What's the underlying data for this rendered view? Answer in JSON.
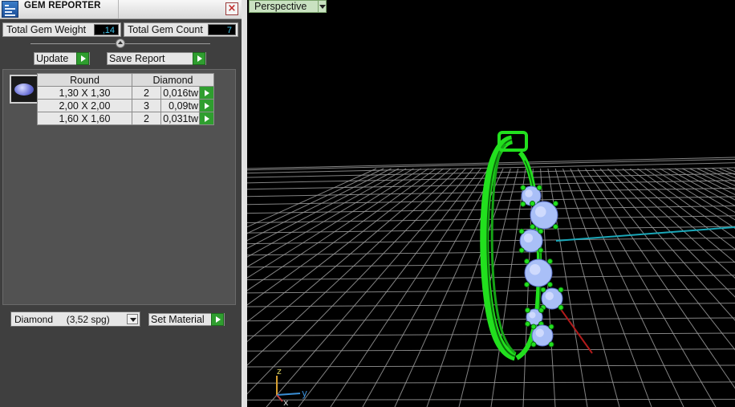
{
  "window": {
    "title": "GEM REPORTER"
  },
  "stats": {
    "weight_label": "Total Gem Weight",
    "weight_value": ",14",
    "count_label": "Total Gem Count",
    "count_value": "7"
  },
  "actions": {
    "update_label": "Update",
    "save_label": "Save Report",
    "set_material_label": "Set Material"
  },
  "gem_table": {
    "headers": [
      "Round",
      "Diamond"
    ],
    "rows": [
      {
        "size": "1,30 X 1,30",
        "count": "2",
        "weight": "0,016tw"
      },
      {
        "size": "2,00 X 2,00",
        "count": "3",
        "weight": "0,09tw"
      },
      {
        "size": "1,60 X 1,60",
        "count": "2",
        "weight": "0,031tw"
      }
    ]
  },
  "material_select": {
    "value": "Diamond     (3,52 spg)"
  },
  "viewport": {
    "view_name": "Perspective",
    "axis_labels": {
      "z": "z",
      "y": "y",
      "x": "x"
    },
    "colors": {
      "model": "#22e01e",
      "gems": "#a9bff7",
      "grid": "#9a9a9a",
      "y_axis": "#1aa7b8",
      "x_axis": "#b11b1b"
    }
  }
}
